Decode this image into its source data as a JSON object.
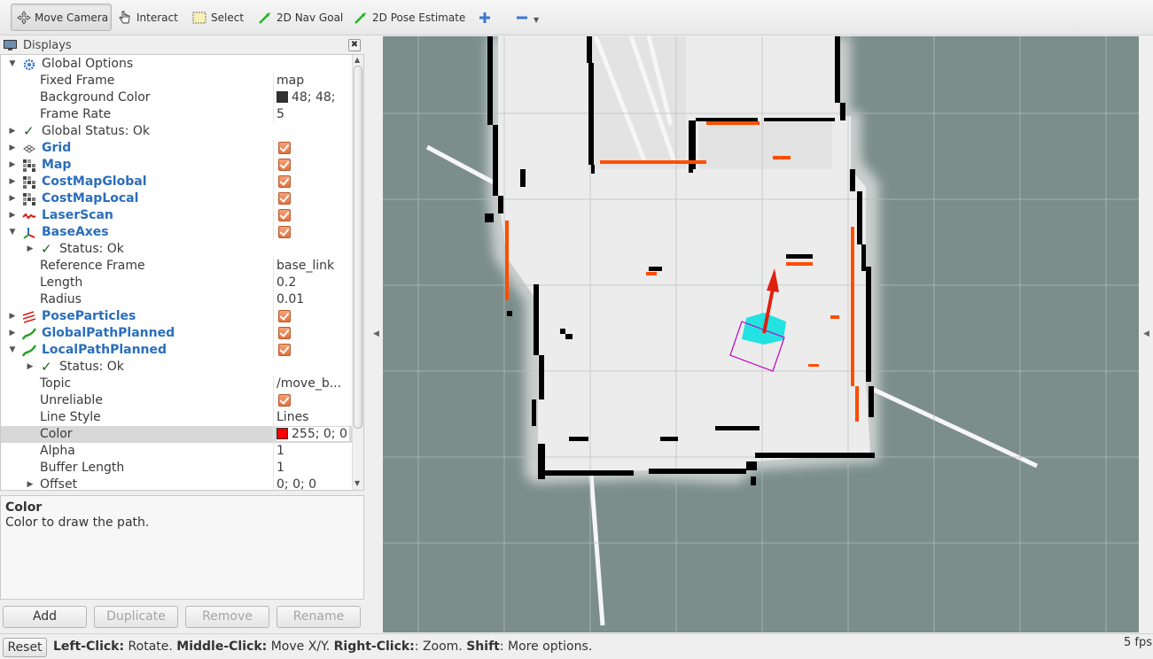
{
  "toolbar": {
    "move_camera": "Move Camera",
    "interact": "Interact",
    "select": "Select",
    "nav_goal": "2D Nav Goal",
    "pose_estimate": "2D Pose Estimate"
  },
  "displays": {
    "title": "Displays",
    "close": "✖",
    "rows": {
      "global_options": "Global Options",
      "fixed_frame": {
        "label": "Fixed Frame",
        "value": "map"
      },
      "background_color": {
        "label": "Background Color",
        "value": "48; 48;",
        "swatch": "#303030"
      },
      "frame_rate": {
        "label": "Frame Rate",
        "value": "5"
      },
      "global_status": "Global Status: Ok",
      "grid": "Grid",
      "map": "Map",
      "costmap_global": "CostMapGlobal",
      "costmap_local": "CostMapLocal",
      "laserscan": "LaserScan",
      "baseaxes": "BaseAxes",
      "baseaxes_status": "Status: Ok",
      "reference_frame": {
        "label": "Reference Frame",
        "value": "base_link"
      },
      "length": {
        "label": "Length",
        "value": "0.2"
      },
      "radius": {
        "label": "Radius",
        "value": "0.01"
      },
      "pose_particles": "PoseParticles",
      "global_path": "GlobalPathPlanned",
      "local_path": "LocalPathPlanned",
      "local_status": "Status: Ok",
      "topic": {
        "label": "Topic",
        "value": "/move_b..."
      },
      "unreliable": {
        "label": "Unreliable"
      },
      "line_style": {
        "label": "Line Style",
        "value": "Lines"
      },
      "color": {
        "label": "Color",
        "value": "255; 0; 0",
        "swatch": "#ff0000"
      },
      "alpha": {
        "label": "Alpha",
        "value": "1"
      },
      "buffer_length": {
        "label": "Buffer Length",
        "value": "1"
      },
      "offset": {
        "label": "Offset",
        "value": "0; 0; 0"
      }
    }
  },
  "description": {
    "title": "Color",
    "text": "Color to draw the path."
  },
  "buttons": {
    "add": "Add",
    "duplicate": "Duplicate",
    "remove": "Remove",
    "rename": "Rename"
  },
  "statusbar": {
    "reset": "Reset",
    "k1": "Left-Click:",
    "v1": " Rotate. ",
    "k2": "Middle-Click:",
    "v2": " Move X/Y. ",
    "k3": "Right-Click:",
    "v3": ": Zoom. ",
    "k4": "Shift",
    "v4": ": More options.",
    "fps": "5 fps"
  },
  "colors": {
    "viewport_bg": "#7b8e8a",
    "map_free": "#eeeeee",
    "obstacle": "#000000",
    "laser": "#ff4d00",
    "particles": "#00e5e5",
    "axis_arrow": "#e0200f",
    "footprint": "#c000c0"
  }
}
